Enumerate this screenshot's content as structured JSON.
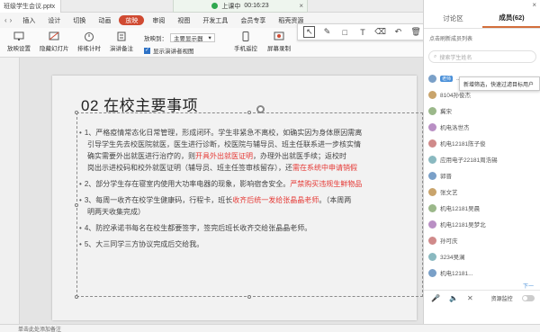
{
  "app": {
    "doc_tab_title": "班级学生会议.pptx"
  },
  "menubar": {
    "items": [
      "插入",
      "设计",
      "切换",
      "动画",
      "放映",
      "审阅",
      "视图",
      "开发工具",
      "会员专享",
      "稻壳资源"
    ],
    "active": "放映"
  },
  "ribbon": {
    "buttons": [
      {
        "label": "放映设置",
        "icon": "slideshow-settings-icon"
      },
      {
        "label": "隐藏幻灯片",
        "icon": "hide-slide-icon"
      },
      {
        "label": "排练计时",
        "icon": "timer-icon"
      },
      {
        "label": "演讲备注",
        "icon": "speaker-notes-icon"
      },
      {
        "label": "手机遥控",
        "icon": "phone-remote-icon"
      },
      {
        "label": "屏幕录制",
        "icon": "screen-record-icon"
      }
    ],
    "present_to_label": "放映到：",
    "present_to_value": "主要显示器",
    "presenter_view_label": "显示演讲者视图"
  },
  "meeting": {
    "status_label": "上课中",
    "elapsed_time": "00:16:23"
  },
  "slide": {
    "title": "02 在校主要事项",
    "bullets": [
      {
        "lines": [
          {
            "parts": [
              {
                "t": "1、严格疫情常态化日常管理，形成闭环。学生非紧急不离校，如确实因为身体原因需离"
              }
            ]
          },
          {
            "parts": [
              {
                "t": "引导学生先去校医院就医，医生进行诊断，校医院与辅导员、班主任联系进一步核实情"
              }
            ]
          },
          {
            "parts": [
              {
                "t": "确实需要外出就医进行治疗的，则"
              },
              {
                "t": "开具外出就医证明",
                "red": true
              },
              {
                "t": "，办理外出就医手续；返校时"
              }
            ]
          },
          {
            "parts": [
              {
                "t": "岗出示进校码和校外就医证明（辅导员、班主任签审核留存），还"
              },
              {
                "t": "需在系统中申请销假",
                "red": true
              }
            ]
          }
        ]
      },
      {
        "lines": [
          {
            "parts": [
              {
                "t": "2、部分学生存在寝室内使用大功率电器的现象，影响宿舍安全。"
              },
              {
                "t": "严禁购买违规生鲜物品",
                "red": true
              }
            ]
          }
        ]
      },
      {
        "lines": [
          {
            "parts": [
              {
                "t": "3、每周一收齐在校学生健康码，行程卡，班长"
              },
              {
                "t": "收齐后统一发给张晶晶老师",
                "red": true
              },
              {
                "t": "。（本周两"
              }
            ]
          },
          {
            "parts": [
              {
                "t": "明两天收集完成）"
              }
            ]
          }
        ]
      },
      {
        "lines": [
          {
            "parts": [
              {
                "t": "4、防控承诺书每名在校生都要签字，签完后班长收齐交给张晶晶老师。"
              }
            ]
          }
        ]
      },
      {
        "lines": [
          {
            "parts": [
              {
                "t": "5、大三同学三方协议完成后交给我。"
              }
            ]
          }
        ]
      }
    ]
  },
  "annotation_toolbar": {
    "tools": [
      {
        "name": "pointer",
        "icon": "cursor-icon",
        "glyph": "↖"
      },
      {
        "name": "pen",
        "icon": "pen-icon",
        "glyph": "✎"
      },
      {
        "name": "shape",
        "icon": "rectangle-icon",
        "glyph": "□"
      },
      {
        "name": "text",
        "icon": "text-icon",
        "glyph": "T"
      },
      {
        "name": "eraser",
        "icon": "eraser-icon",
        "glyph": "⌫"
      },
      {
        "name": "undo",
        "icon": "undo-icon",
        "glyph": "↶"
      },
      {
        "name": "clear",
        "icon": "trash-icon",
        "glyph": "🗑"
      }
    ]
  },
  "panel": {
    "tab_discussion": "讨论区",
    "tab_members": "成员(62)",
    "notice": "点击刷新成员列表",
    "search_placeholder": "搜索学生姓名",
    "tooltip": "新增筛选，快速过滤目标用户",
    "members": [
      {
        "name": "...",
        "tag": "老师"
      },
      {
        "name": "8104孙俊杰"
      },
      {
        "name": "冀宋"
      },
      {
        "name": "机电洛世杰"
      },
      {
        "name": "机电12181陈子俊"
      },
      {
        "name": "应用电子22181周浩锡"
      },
      {
        "name": "郭晋"
      },
      {
        "name": "张文艺"
      },
      {
        "name": "机电12181吴晨"
      },
      {
        "name": "机电12181吴梦北"
      },
      {
        "name": "孙可庆"
      },
      {
        "name": "3234吴澜"
      },
      {
        "name": "机电12181..."
      }
    ],
    "monitor_label": "资源监控",
    "next_label": "下一"
  },
  "statusbar": {
    "text": "单击此处添加备注"
  }
}
